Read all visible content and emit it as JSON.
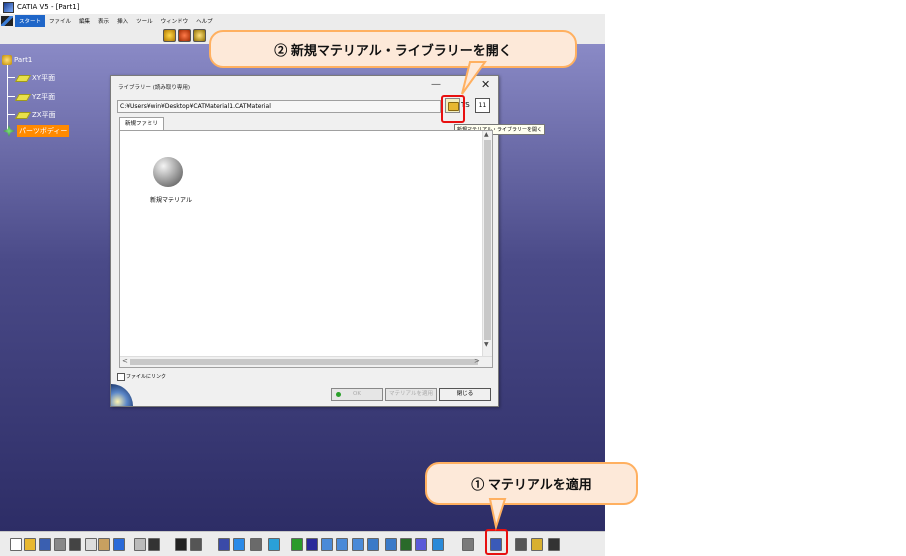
{
  "window": {
    "title": "CATIA V5 - [Part1]"
  },
  "menu": {
    "items": [
      "スタート",
      "ファイル",
      "編集",
      "表示",
      "挿入",
      "ツール",
      "ウィンドウ",
      "ヘルプ"
    ]
  },
  "tree": {
    "root": "Part1",
    "children": [
      "XY平面",
      "YZ平面",
      "ZX平面"
    ],
    "body": "パーツボディー"
  },
  "dialog": {
    "title": "ライブラリー (読み取り専用)",
    "min_glyph": "—",
    "close_glyph": "✕",
    "path": "C:¥Users¥win¥Desktop¥CATMaterial1.CATMaterial",
    "ts_label": "TS",
    "extra_glyph": "11",
    "tooltip": "新規マテリアル・ライブラリーを開く",
    "tab": "新規ファミリ",
    "material_label": "新規マテリアル",
    "link_label": "ファイルにリンク",
    "ok_label": "OK",
    "apply_label": "マテリアルを適用",
    "close_label": "閉じる",
    "scroll_up": "▲",
    "scroll_down": "▼",
    "scroll_left": "<",
    "scroll_right": ">"
  },
  "callouts": {
    "step2": "② 新規マテリアル・ライブラリーを開く",
    "step1": "① マテリアルを適用"
  },
  "colors": {
    "viewport_top": "#8a8ac6",
    "viewport_bottom": "#2d2d66",
    "callout_fill": "#fde9d9",
    "callout_border": "#ffb060",
    "highlight": "#e81010",
    "body_label": "#ff8a00"
  }
}
